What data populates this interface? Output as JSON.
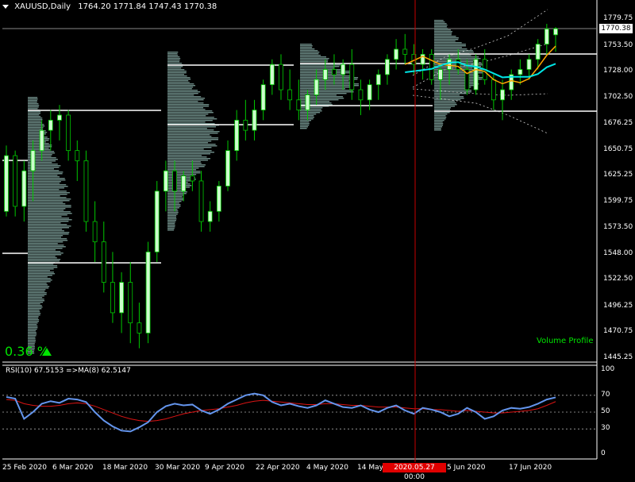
{
  "header": {
    "symbol_title": "XAUUSD,Daily",
    "ohlc": "1764.20 1771.84 1747.43 1770.38"
  },
  "indicators": {
    "change_percent": "0.36 %",
    "volume_profile_label": "Volume Profile",
    "rsi_label": "RSI(10) 67.5153   =>MA(8) 62.5147"
  },
  "price_axis": {
    "labels": [
      "1779.75",
      "1753.50",
      "1728.00",
      "1702.50",
      "1676.25",
      "1650.75",
      "1625.25",
      "1599.75",
      "1573.50",
      "1548.00",
      "1522.50",
      "1496.25",
      "1470.75",
      "1445.25"
    ],
    "current_price": "1770.38"
  },
  "rsi_axis": {
    "labels": [
      "100",
      "70",
      "50",
      "30",
      "0"
    ]
  },
  "time_axis": {
    "labels": [
      "25 Feb 2020",
      "6 Mar 2020",
      "18 Mar 2020",
      "30 Mar 2020",
      "9 Apr 2020",
      "22 Apr 2020",
      "4 May 2020",
      "14 May",
      "5 Jun 2020",
      "17 Jun 2020"
    ],
    "crosshair_label": "2020.05.27 00:00",
    "crosshair_tail": "0"
  },
  "colors": {
    "background": "#000000",
    "bull_candle": "#ccffcc",
    "wick": "#00c800",
    "volume_profile": "#6e8c87",
    "crosshair": "#c80000",
    "rsi_line": "#6495ed",
    "rsi_ma": "#dc1414",
    "ma_fast": "#ffa500",
    "ma_slow": "#00e5e5",
    "text_green": "#00e600"
  },
  "chart_data": {
    "type": "candlestick",
    "symbol": "XAUUSD",
    "timeframe": "Daily",
    "ylim": [
      1445.25,
      1790
    ],
    "candles": [
      [
        1590,
        1655,
        1585,
        1645
      ],
      [
        1645,
        1650,
        1585,
        1595
      ],
      [
        1595,
        1640,
        1580,
        1630
      ],
      [
        1630,
        1660,
        1600,
        1650
      ],
      [
        1650,
        1680,
        1640,
        1670
      ],
      [
        1670,
        1690,
        1650,
        1680
      ],
      [
        1680,
        1695,
        1660,
        1685
      ],
      [
        1685,
        1690,
        1640,
        1650
      ],
      [
        1650,
        1660,
        1620,
        1640
      ],
      [
        1640,
        1650,
        1570,
        1580
      ],
      [
        1580,
        1600,
        1540,
        1560
      ],
      [
        1560,
        1580,
        1510,
        1520
      ],
      [
        1520,
        1550,
        1480,
        1490
      ],
      [
        1490,
        1530,
        1470,
        1520
      ],
      [
        1520,
        1540,
        1460,
        1480
      ],
      [
        1480,
        1500,
        1455,
        1470
      ],
      [
        1470,
        1560,
        1460,
        1550
      ],
      [
        1550,
        1620,
        1540,
        1610
      ],
      [
        1610,
        1640,
        1590,
        1630
      ],
      [
        1630,
        1640,
        1590,
        1610
      ],
      [
        1610,
        1630,
        1600,
        1625
      ],
      [
        1625,
        1640,
        1610,
        1620
      ],
      [
        1620,
        1630,
        1570,
        1580
      ],
      [
        1580,
        1600,
        1570,
        1590
      ],
      [
        1590,
        1620,
        1580,
        1615
      ],
      [
        1615,
        1660,
        1610,
        1650
      ],
      [
        1650,
        1690,
        1640,
        1680
      ],
      [
        1680,
        1700,
        1660,
        1670
      ],
      [
        1670,
        1700,
        1660,
        1690
      ],
      [
        1690,
        1720,
        1680,
        1715
      ],
      [
        1715,
        1740,
        1705,
        1735
      ],
      [
        1735,
        1745,
        1700,
        1710
      ],
      [
        1710,
        1730,
        1690,
        1700
      ],
      [
        1700,
        1720,
        1680,
        1690
      ],
      [
        1690,
        1710,
        1680,
        1705
      ],
      [
        1705,
        1730,
        1695,
        1720
      ],
      [
        1720,
        1740,
        1710,
        1730
      ],
      [
        1730,
        1745,
        1715,
        1725
      ],
      [
        1725,
        1740,
        1710,
        1735
      ],
      [
        1735,
        1750,
        1700,
        1710
      ],
      [
        1710,
        1720,
        1685,
        1700
      ],
      [
        1700,
        1720,
        1690,
        1715
      ],
      [
        1715,
        1730,
        1700,
        1725
      ],
      [
        1725,
        1745,
        1715,
        1740
      ],
      [
        1740,
        1760,
        1730,
        1750
      ],
      [
        1750,
        1765,
        1735,
        1745
      ],
      [
        1745,
        1755,
        1725,
        1735
      ],
      [
        1735,
        1750,
        1720,
        1745
      ],
      [
        1745,
        1750,
        1715,
        1720
      ],
      [
        1720,
        1735,
        1700,
        1730
      ],
      [
        1730,
        1745,
        1715,
        1740
      ],
      [
        1740,
        1750,
        1725,
        1730
      ],
      [
        1730,
        1740,
        1705,
        1710
      ],
      [
        1710,
        1745,
        1705,
        1740
      ],
      [
        1740,
        1750,
        1715,
        1720
      ],
      [
        1720,
        1725,
        1690,
        1700
      ],
      [
        1700,
        1720,
        1680,
        1710
      ],
      [
        1710,
        1730,
        1700,
        1725
      ],
      [
        1725,
        1740,
        1715,
        1730
      ],
      [
        1730,
        1745,
        1720,
        1740
      ],
      [
        1740,
        1760,
        1730,
        1755
      ],
      [
        1755,
        1775,
        1745,
        1770
      ],
      [
        1764.2,
        1771.84,
        1747.43,
        1770.38
      ]
    ],
    "rsi": [
      68,
      66,
      42,
      50,
      60,
      63,
      61,
      66,
      65,
      62,
      50,
      40,
      33,
      28,
      27,
      32,
      38,
      50,
      57,
      60,
      58,
      59,
      52,
      48,
      53,
      60,
      65,
      70,
      72,
      70,
      62,
      58,
      60,
      57,
      55,
      58,
      64,
      60,
      56,
      55,
      58,
      53,
      50,
      55,
      58,
      52,
      48,
      55,
      53,
      50,
      45,
      48,
      55,
      50,
      42,
      45,
      52,
      55,
      54,
      56,
      60,
      65,
      67.5
    ],
    "rsi_ma": [
      65,
      64,
      60,
      58,
      57,
      57,
      58,
      60,
      61,
      60,
      57,
      53,
      49,
      45,
      42,
      40,
      39,
      40,
      42,
      45,
      48,
      50,
      52,
      53,
      54,
      56,
      58,
      61,
      63,
      64,
      63,
      62,
      61,
      60,
      59,
      59,
      60,
      60,
      59,
      58,
      58,
      57,
      56,
      56,
      56,
      55,
      54,
      54,
      53,
      53,
      52,
      51,
      52,
      51,
      50,
      49,
      49,
      50,
      51,
      52,
      54,
      58,
      62.5
    ],
    "rsi_levels": [
      70,
      50,
      30
    ],
    "rsi_ylim": [
      0,
      100
    ]
  }
}
